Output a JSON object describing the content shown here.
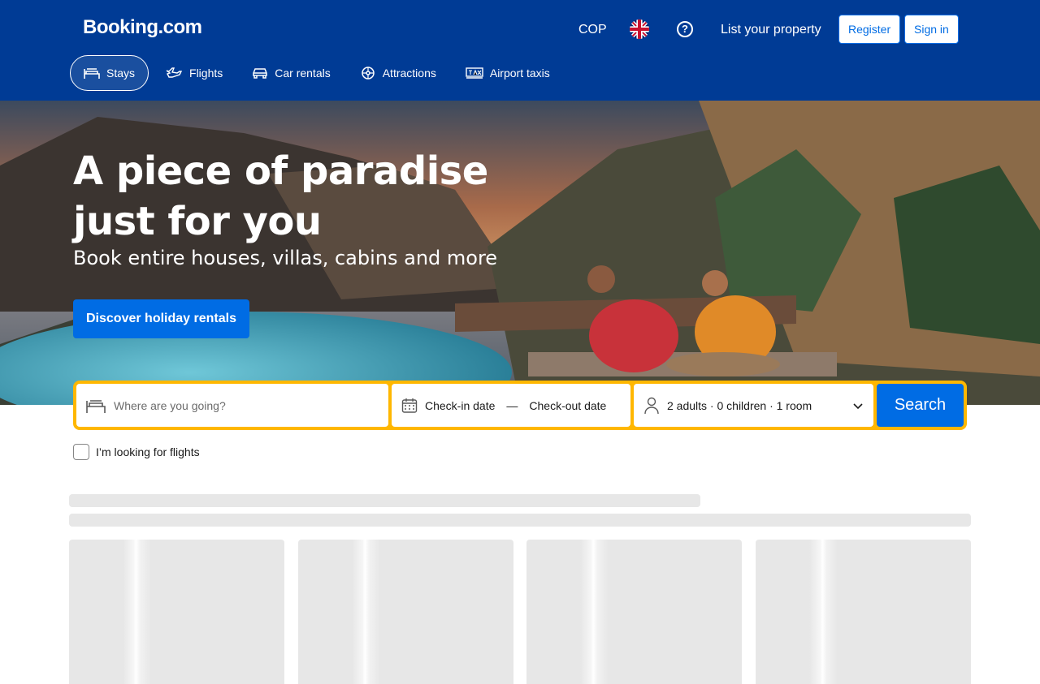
{
  "header": {
    "logo": "Booking.com",
    "currency": "COP",
    "language_icon": "uk-flag-icon",
    "help_icon": "question-circle-icon",
    "help_glyph": "?",
    "list_property": "List your property",
    "register": "Register",
    "sign_in": "Sign in",
    "background_color": "#003b95"
  },
  "nav": {
    "items": [
      {
        "label": "Stays",
        "icon": "bed-icon",
        "active": true
      },
      {
        "label": "Flights",
        "icon": "plane-icon",
        "active": false
      },
      {
        "label": "Car rentals",
        "icon": "car-icon",
        "active": false
      },
      {
        "label": "Attractions",
        "icon": "attractions-icon",
        "active": false
      },
      {
        "label": "Airport taxis",
        "icon": "taxi-icon",
        "active": false
      }
    ]
  },
  "hero": {
    "title": "A piece of paradise just for you",
    "subtitle": "Book entire houses, villas, cabins and more",
    "cta": "Discover holiday rentals"
  },
  "search": {
    "destination_placeholder": "Where are you going?",
    "check_in": "Check-in date",
    "date_separator": "—",
    "check_out": "Check-out date",
    "guests": "2 adults · 0 children · 1 room",
    "search_button": "Search",
    "accent_color": "#ffb700",
    "button_color": "#006ce4"
  },
  "flights_checkbox": {
    "label": "I’m looking for flights",
    "checked": false
  }
}
